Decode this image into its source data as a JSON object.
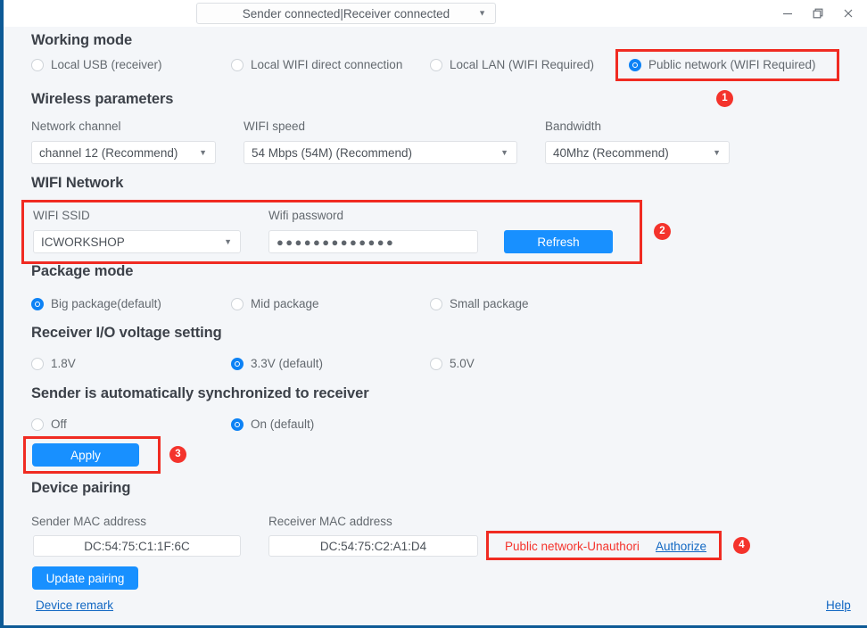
{
  "titlebar": {
    "status_value": "Sender connected|Receiver connected",
    "caret": "▼",
    "minimize_label": "minimize-icon",
    "restore_label": "restore-icon",
    "close_label": "close-icon"
  },
  "working_mode": {
    "title": "Working mode",
    "options": [
      {
        "label": "Local USB (receiver)",
        "selected": false
      },
      {
        "label": "Local WIFI direct connection",
        "selected": false
      },
      {
        "label": "Local LAN (WIFI Required)",
        "selected": false
      },
      {
        "label": "Public network (WIFI Required)",
        "selected": true
      }
    ]
  },
  "wireless": {
    "title": "Wireless parameters",
    "network_channel": {
      "label": "Network channel",
      "value": "channel 12 (Recommend)"
    },
    "wifi_speed": {
      "label": "WIFI speed",
      "value": "54 Mbps (54M)  (Recommend)"
    },
    "bandwidth": {
      "label": "Bandwidth",
      "value": "40Mhz (Recommend)"
    }
  },
  "wifi_network": {
    "title": "WIFI Network",
    "ssid": {
      "label": "WIFI SSID",
      "value": "ICWORKSHOP"
    },
    "password": {
      "label": "Wifi password",
      "value": "●●●●●●●●●●●●●"
    },
    "refresh_label": "Refresh"
  },
  "package_mode": {
    "title": "Package mode",
    "options": [
      {
        "label": "Big package(default)",
        "selected": true
      },
      {
        "label": "Mid package",
        "selected": false
      },
      {
        "label": "Small package",
        "selected": false
      }
    ]
  },
  "voltage": {
    "title": "Receiver I/O voltage setting",
    "options": [
      {
        "label": "1.8V",
        "selected": false
      },
      {
        "label": "3.3V (default)",
        "selected": true
      },
      {
        "label": "5.0V",
        "selected": false
      }
    ]
  },
  "sync": {
    "title": "Sender is automatically synchronized to receiver",
    "options": [
      {
        "label": "Off",
        "selected": false
      },
      {
        "label": "On (default)",
        "selected": true
      }
    ],
    "apply_label": "Apply"
  },
  "pairing": {
    "title": "Device pairing",
    "sender_mac": {
      "label": "Sender MAC address",
      "value": "DC:54:75:C1:1F:6C"
    },
    "receiver_mac": {
      "label": "Receiver MAC address",
      "value": "DC:54:75:C2:A1:D4"
    },
    "auth_status": "Public network-Unauthori",
    "authorize_label": "Authorize",
    "update_pairing_label": "Update pairing"
  },
  "footer": {
    "device_remark_label": "Device remark",
    "help_label": "Help"
  },
  "badges": [
    "1",
    "2",
    "3",
    "4"
  ],
  "colors": {
    "accent": "#1890ff",
    "radio_on": "#0d82f5",
    "highlight": "#f02b22",
    "badge": "#f4332c",
    "window_border": "#0d5a96",
    "background": "#f4f6f9",
    "link": "#1268c3"
  }
}
